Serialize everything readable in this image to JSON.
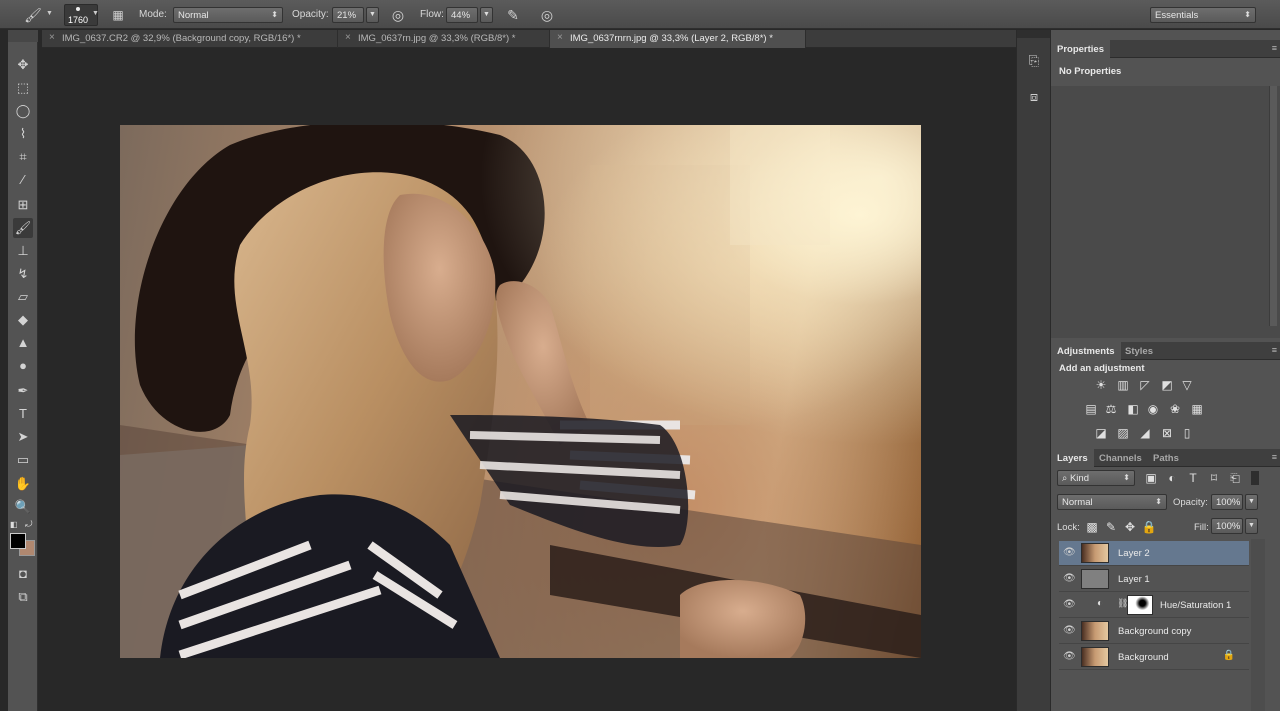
{
  "options_bar": {
    "brush_size": "1760",
    "mode_label": "Mode:",
    "mode_value": "Normal",
    "opacity_label": "Opacity:",
    "opacity_value": "21%",
    "flow_label": "Flow:",
    "flow_value": "44%",
    "workspace": "Essentials"
  },
  "tabs": [
    {
      "label": "IMG_0637.CR2 @ 32,9% (Background copy, RGB/16*) *",
      "active": false
    },
    {
      "label": "IMG_0637rn.jpg @ 33,3% (RGB/8*) *",
      "active": false
    },
    {
      "label": "IMG_0637rnrn.jpg @ 33,3% (Layer 2, RGB/8*) *",
      "active": true
    }
  ],
  "properties": {
    "tab_label": "Properties",
    "status": "No Properties"
  },
  "adjustments": {
    "tab_label": "Adjustments",
    "styles_tab": "Styles",
    "heading": "Add an adjustment"
  },
  "layers_panel": {
    "tabs": [
      "Layers",
      "Channels",
      "Paths"
    ],
    "filter_label": "Kind",
    "blend_mode": "Normal",
    "opacity_label": "Opacity:",
    "opacity_value": "100%",
    "lock_label": "Lock:",
    "fill_label": "Fill:",
    "fill_value": "100%",
    "layers": [
      {
        "name": "Layer 2",
        "selected": true
      },
      {
        "name": "Layer 1",
        "selected": false
      },
      {
        "name": "Hue/Saturation 1",
        "selected": false
      },
      {
        "name": "Background copy",
        "selected": false
      },
      {
        "name": "Background",
        "selected": false
      }
    ]
  },
  "colors": {
    "foreground": "#000000",
    "background": "#b08870",
    "selected_layer": "#65788f"
  }
}
